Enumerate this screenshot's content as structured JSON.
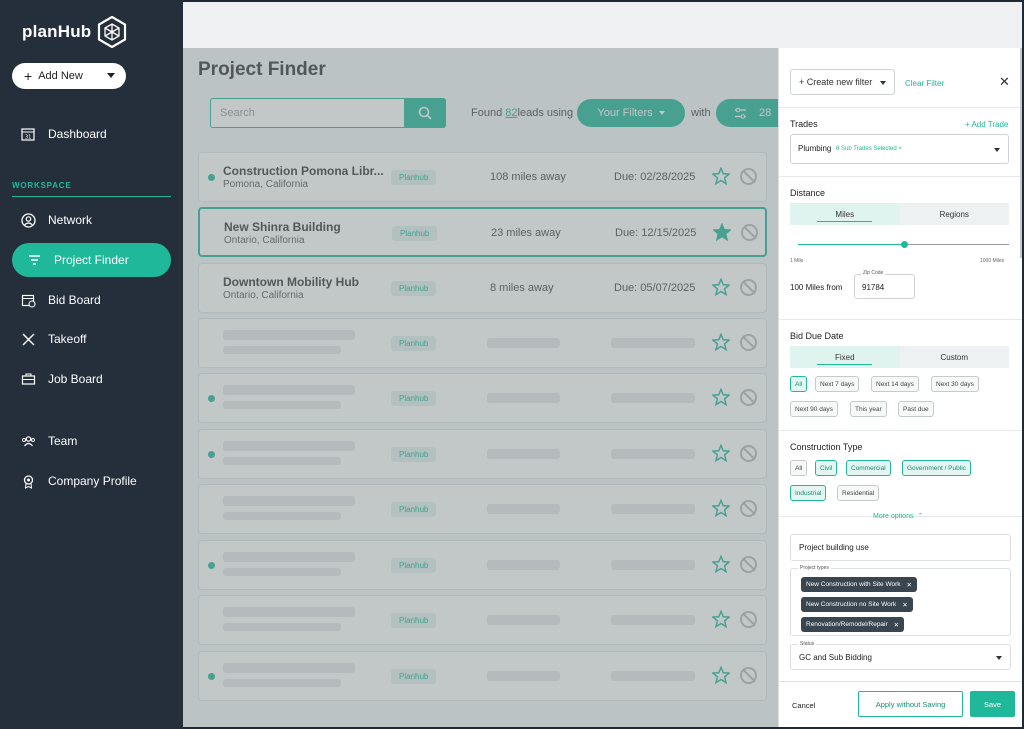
{
  "brand": {
    "name": "planHub"
  },
  "sidebar": {
    "add_new": "Add New",
    "dashboard": "Dashboard",
    "workspace_label": "WORKSPACE",
    "items": [
      {
        "label": "Network",
        "icon": "user-circle-icon"
      },
      {
        "label": "Project Finder",
        "icon": "funnel-icon",
        "active": true
      },
      {
        "label": "Bid Board",
        "icon": "calendar-icon"
      },
      {
        "label": "Takeoff",
        "icon": "ruler-pencil-icon"
      },
      {
        "label": "Job Board",
        "icon": "briefcase-icon"
      }
    ],
    "bottom_items": [
      {
        "label": "Team",
        "icon": "team-icon"
      },
      {
        "label": "Company Profile",
        "icon": "badge-icon"
      }
    ]
  },
  "main": {
    "title": "Project Finder",
    "search_placeholder": "Search",
    "found_prefix": "Found",
    "found_count": "82",
    "found_suffix": "leads using",
    "filters_label": "Your Filters",
    "with_label": "with",
    "trades_count": "28",
    "projects": [
      {
        "name": "Construction Pomona Libr...",
        "location": "Pomona, California",
        "source": "Planhub",
        "distance": "108 miles away",
        "due": "Due: 02/28/2025",
        "starred": false,
        "new": true
      },
      {
        "name": "New Shinra Building",
        "location": "Ontario, California",
        "source": "Planhub",
        "distance": "23 miles away",
        "due": "Due: 12/15/2025",
        "starred": true,
        "new": false
      },
      {
        "name": "Downtown Mobility Hub",
        "location": "Ontario, California",
        "source": "Planhub",
        "distance": "8 miles away",
        "due": "Due: 05/07/2025",
        "starred": false,
        "new": false
      }
    ],
    "placeholder_source": "Planhub"
  },
  "panel": {
    "create_filter": "+ Create new filter",
    "clear_filter": "Clear Filter",
    "trades_title": "Trades",
    "add_trade": "+ Add Trade",
    "trade_name": "Plumbing",
    "trade_count": "6 Sub Trades Selected ×",
    "distance_title": "Distance",
    "distance_tabs": [
      "Miles",
      "Regions"
    ],
    "distance_value": 0.5,
    "slider_min": "1 Mile",
    "slider_max": "1000 Miles",
    "miles_from": "100 Miles from",
    "zip_caption": "Zip Code",
    "zip_value": "91784",
    "bid_due_title": "Bid Due Date",
    "bid_due_tabs": [
      "Fixed",
      "Custom"
    ],
    "bid_due_chips": [
      {
        "label": "All",
        "on": true
      },
      {
        "label": "Next 7 days",
        "on": false
      },
      {
        "label": "Next 14 days",
        "on": false
      },
      {
        "label": "Next 30 days",
        "on": false
      },
      {
        "label": "Next 90 days",
        "on": false
      },
      {
        "label": "This year",
        "on": false
      },
      {
        "label": "Past due",
        "on": false
      }
    ],
    "construction_title": "Construction Type",
    "construction_chips": [
      {
        "label": "All",
        "on": false
      },
      {
        "label": "Civil",
        "on": true
      },
      {
        "label": "Commercial",
        "on": true
      },
      {
        "label": "Government / Public",
        "on": true
      },
      {
        "label": "Industrial",
        "on": true
      },
      {
        "label": "Residential",
        "on": false
      }
    ],
    "more_options": "More options",
    "building_use_placeholder": "Project building use",
    "project_types_caption": "Project types",
    "project_types": [
      "New Construction with Site Work",
      "New Construction no Site Work",
      "Renovation/Remodel/Repair"
    ],
    "status_caption": "Status",
    "status_value": "GC and Sub Bidding",
    "cancel": "Cancel",
    "apply": "Apply without Saving",
    "save": "Save"
  },
  "colors": {
    "accent": "#1fb89a",
    "sidebar": "#242f3b"
  }
}
